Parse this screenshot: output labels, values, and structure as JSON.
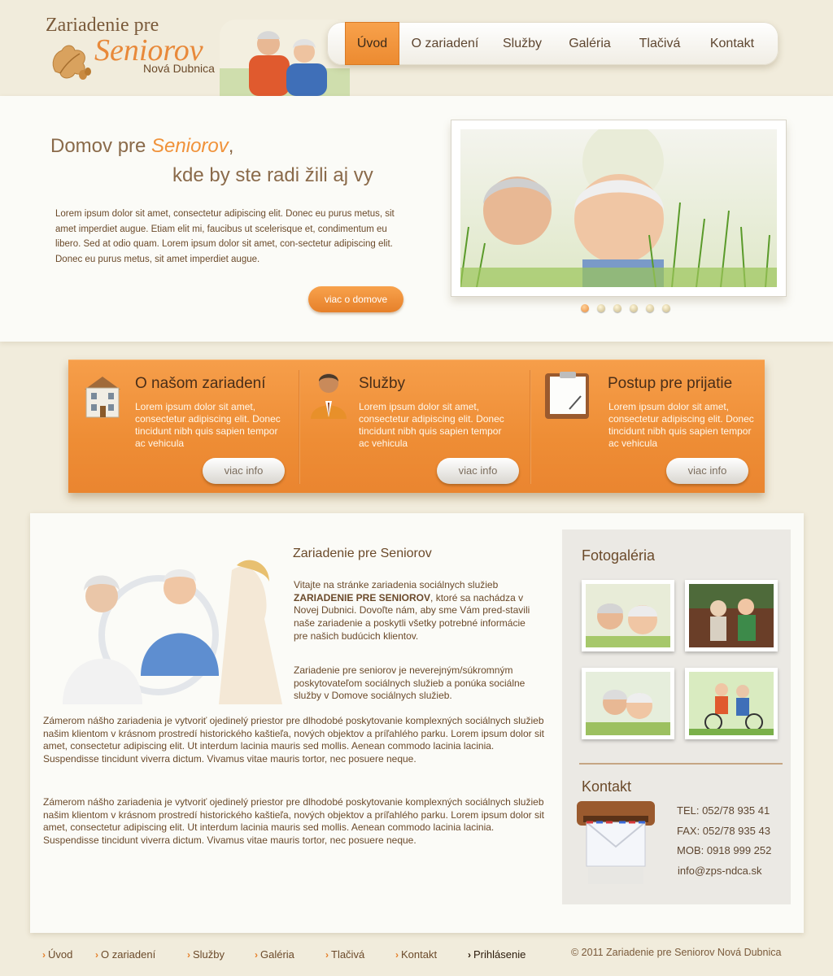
{
  "logo": {
    "line1": "Zariadenie pre",
    "line2": "Seniorov",
    "line3": "Nová Dubnica"
  },
  "nav": {
    "items": [
      {
        "label": "Úvod",
        "active": true
      },
      {
        "label": "O zariadení",
        "active": false
      },
      {
        "label": "Služby",
        "active": false
      },
      {
        "label": "Galéria",
        "active": false
      },
      {
        "label": "Tlačivá",
        "active": false
      },
      {
        "label": "Kontakt",
        "active": false
      }
    ]
  },
  "hero": {
    "title_part1": "Domov pre ",
    "title_accent": "Seniorov",
    "title_comma": ",",
    "title_line2": "kde by ste radi žili aj vy",
    "text": "Lorem ipsum dolor sit amet, consectetur adipiscing elit. Donec eu purus metus, sit amet imperdiet augue. Etiam elit mi, faucibus ut scelerisque et, condimentum eu libero. Sed at odio quam. Lorem ipsum dolor sit amet, con-sectetur adipiscing elit. Donec eu purus metus, sit amet imperdiet augue.",
    "button": "viac o domove",
    "slide_count": 6,
    "active_slide": 1
  },
  "features": [
    {
      "title": "O našom zariadení",
      "text": "Lorem ipsum dolor sit amet, consectetur adipiscing elit. Donec tincidunt nibh quis sapien tempor ac vehicula",
      "button": "viac info",
      "icon": "house-icon"
    },
    {
      "title": "Služby",
      "text": "Lorem ipsum dolor sit amet, consectetur adipiscing elit. Donec tincidunt nibh quis sapien tempor ac vehicula",
      "button": "viac info",
      "icon": "person-icon"
    },
    {
      "title": "Postup pre prijatie",
      "text": "Lorem ipsum dolor sit amet, consectetur adipiscing elit. Donec tincidunt nibh quis sapien tempor ac vehicula",
      "button": "viac info",
      "icon": "clipboard-icon"
    }
  ],
  "about": {
    "title": "Zariadenie pre Seniorov",
    "p1_before": "Vitajte na stránke zariadenia sociálnych služieb ",
    "p1_bold": "ZARIADENIE PRE SENIOROV",
    "p1_after": ", ktoré sa nachádza v Novej Dubnici. Dovoľte nám, aby sme Vám pred-stavili naše zariadenie a poskytli všetky potrebné informácie pre našich budúcich klientov.",
    "p2": "Zariadenie pre seniorov je neverejným/súkromným poskytovateľom sociálnych služieb a ponúka sociálne služby v Domove sociálnych služieb.",
    "p3": "Zámerom nášho zariadenia je vytvoriť ojedinelý priestor pre dlhodobé poskytovanie komplexných sociálnych služieb našim klientom v krásnom prostredí historického kaštieľa, nových objektov a príľahlého parku. Lorem ipsum dolor sit amet, consectetur adipiscing elit. Ut interdum lacinia mauris sed mollis. Aenean commodo lacinia lacinia. Suspendisse tincidunt viverra dictum. Vivamus vitae mauris tortor, nec posuere neque.",
    "p4": "Zámerom nášho zariadenia je vytvoriť ojedinelý priestor pre dlhodobé poskytovanie komplexných sociálnych služieb našim klientom v krásnom prostredí historického kaštieľa, nových objektov a príľahlého parku. Lorem ipsum dolor sit amet, consectetur adipiscing elit. Ut interdum lacinia mauris sed mollis. Aenean commodo lacinia lacinia. Suspendisse tincidunt viverra dictum. Vivamus vitae mauris tortor, nec posuere neque."
  },
  "sidebar": {
    "gallery_title": "Fotogaléria",
    "thumb_count": 4,
    "contact_title": "Kontakt",
    "tel": "TEL: 052/78 935 41",
    "fax": "FAX: 052/78 935 43",
    "mob": "MOB: 0918 999 252",
    "email": "info@zps-ndca.sk"
  },
  "footer": {
    "links": [
      {
        "label": "Úvod"
      },
      {
        "label": "O zariadení"
      },
      {
        "label": "Služby"
      },
      {
        "label": "Galéria"
      },
      {
        "label": "Tlačivá"
      },
      {
        "label": "Kontakt"
      },
      {
        "label": "Prihlásenie"
      }
    ],
    "copyright": "© 2011 Zariadenie pre Seniorov Nová Dubnica"
  },
  "colors": {
    "accent_orange": "#ec8a30",
    "page_bg": "#f1ecdc",
    "text_brown": "#6b4a2a"
  }
}
